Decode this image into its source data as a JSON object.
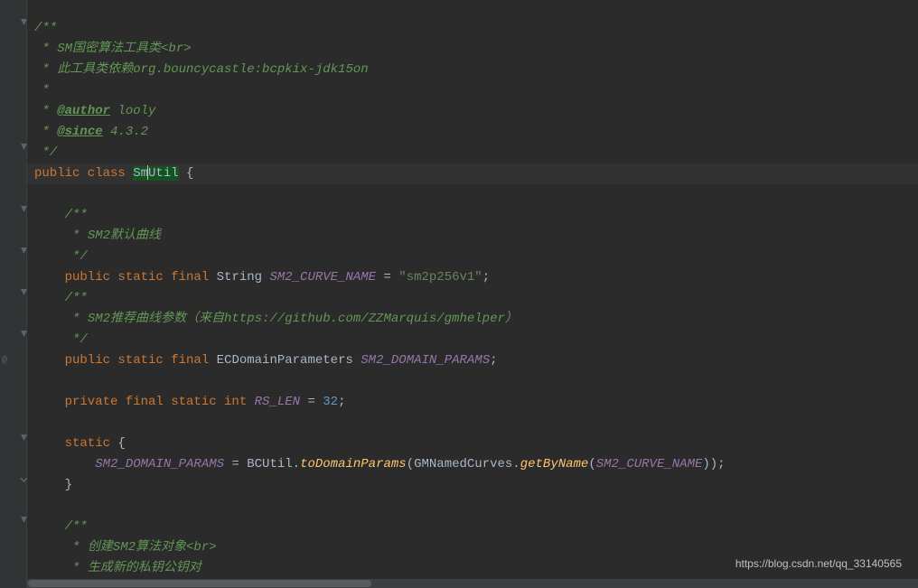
{
  "code": {
    "l1": "/**",
    "l2_prefix": " * ",
    "l2_text": "SM国密算法工具类",
    "l2_br": "<br>",
    "l3_prefix": " * ",
    "l3_text": "此工具类依赖org.bouncycastle:bcpkix-jdk15on",
    "l4": " *",
    "l5_prefix": " * ",
    "l5_tag": "@author",
    "l5_val": " looly",
    "l6_prefix": " * ",
    "l6_tag": "@since",
    "l6_val": " 4.3.2",
    "l7": " */",
    "l8_mods": "public class ",
    "l8_class_a": "Sm",
    "l8_class_b": "Util",
    "l8_brace": " {",
    "l9": "",
    "l10": "    /**",
    "l11_prefix": "     * ",
    "l11_text": "SM2默认曲线",
    "l12": "     */",
    "l13_mods": "    public static final ",
    "l13_type": "String ",
    "l13_name": "SM2_CURVE_NAME",
    "l13_eq": " = ",
    "l13_val": "\"sm2p256v1\"",
    "l13_semi": ";",
    "l14": "    /**",
    "l15_prefix": "     * ",
    "l15_text": "SM2推荐曲线参数（来自https://github.com/ZZMarquis/gmhelper）",
    "l16": "     */",
    "l17_mods": "    public static final ",
    "l17_type": "ECDomainParameters ",
    "l17_name": "SM2_DOMAIN_PARAMS",
    "l17_semi": ";",
    "l18": "",
    "l19_mods": "    private final static int ",
    "l19_name": "RS_LEN",
    "l19_eq": " = ",
    "l19_val": "32",
    "l19_semi": ";",
    "l20": "",
    "l21_kw": "    static ",
    "l21_brace": "{",
    "l22_indent": "        ",
    "l22_lhs": "SM2_DOMAIN_PARAMS",
    "l22_eq": " = BCUtil.",
    "l22_m1": "toDomainParams",
    "l22_p1": "(GMNamedCurves.",
    "l22_m2": "getByName",
    "l22_p2": "(",
    "l22_arg": "SM2_CURVE_NAME",
    "l22_p3": "));",
    "l23": "    }",
    "l24": "",
    "l25": "    /**",
    "l26_prefix": "     * ",
    "l26_text": "创建SM2算法对象",
    "l26_br": "<br>",
    "l27_prefix": "     * ",
    "l27_text": "生成新的私钥公钥对"
  },
  "watermark": "https://blog.csdn.net/qq_33140565",
  "indicator_at": "@",
  "fold_positions": [
    20,
    158,
    225,
    273,
    319,
    365,
    480,
    571,
    617
  ],
  "fold_close_positions": [
    411,
    525
  ]
}
